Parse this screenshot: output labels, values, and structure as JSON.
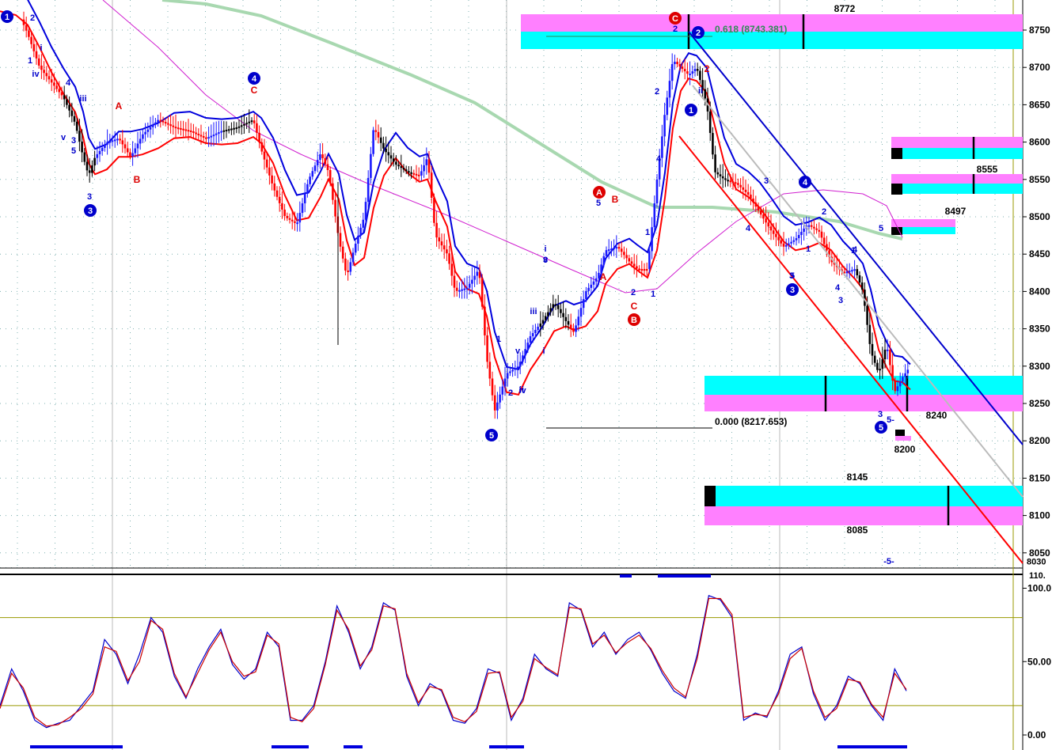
{
  "chart_data": [
    {
      "type": "candlestick",
      "panel": "price",
      "y_axis": {
        "ticks": [
          "8750",
          "8700",
          "8650",
          "8600",
          "8550",
          "8500",
          "8450",
          "8400",
          "8350",
          "8300",
          "8250",
          "8200",
          "8150",
          "8100",
          "8050",
          "8030"
        ],
        "range": [
          8030,
          8785
        ]
      },
      "grid": true,
      "close_path": [
        [
          0,
          8790
        ],
        [
          20,
          8780
        ],
        [
          35,
          8745
        ],
        [
          50,
          8700
        ],
        [
          65,
          8680
        ],
        [
          80,
          8660
        ],
        [
          95,
          8625
        ],
        [
          105,
          8580
        ],
        [
          112,
          8555
        ],
        [
          120,
          8580
        ],
        [
          135,
          8600
        ],
        [
          150,
          8605
        ],
        [
          165,
          8580
        ],
        [
          180,
          8610
        ],
        [
          200,
          8630
        ],
        [
          220,
          8620
        ],
        [
          240,
          8615
        ],
        [
          260,
          8605
        ],
        [
          280,
          8615
        ],
        [
          300,
          8620
        ],
        [
          320,
          8630
        ],
        [
          330,
          8590
        ],
        [
          345,
          8540
        ],
        [
          360,
          8500
        ],
        [
          375,
          8490
        ],
        [
          390,
          8550
        ],
        [
          405,
          8585
        ],
        [
          415,
          8560
        ],
        [
          428,
          8470
        ],
        [
          438,
          8420
        ],
        [
          448,
          8460
        ],
        [
          460,
          8500
        ],
        [
          472,
          8620
        ],
        [
          485,
          8590
        ],
        [
          500,
          8570
        ],
        [
          515,
          8560
        ],
        [
          530,
          8555
        ],
        [
          540,
          8580
        ],
        [
          550,
          8475
        ],
        [
          565,
          8450
        ],
        [
          575,
          8400
        ],
        [
          590,
          8405
        ],
        [
          605,
          8430
        ],
        [
          615,
          8310
        ],
        [
          625,
          8240
        ],
        [
          640,
          8290
        ],
        [
          655,
          8300
        ],
        [
          670,
          8340
        ],
        [
          685,
          8360
        ],
        [
          700,
          8385
        ],
        [
          715,
          8360
        ],
        [
          725,
          8345
        ],
        [
          740,
          8400
        ],
        [
          755,
          8420
        ],
        [
          765,
          8455
        ],
        [
          780,
          8460
        ],
        [
          795,
          8440
        ],
        [
          805,
          8430
        ],
        [
          818,
          8430
        ],
        [
          830,
          8550
        ],
        [
          840,
          8640
        ],
        [
          850,
          8710
        ],
        [
          860,
          8700
        ],
        [
          870,
          8690
        ],
        [
          880,
          8700
        ],
        [
          893,
          8650
        ],
        [
          903,
          8560
        ],
        [
          915,
          8550
        ],
        [
          930,
          8545
        ],
        [
          945,
          8530
        ],
        [
          960,
          8505
        ],
        [
          975,
          8480
        ],
        [
          990,
          8460
        ],
        [
          1005,
          8470
        ],
        [
          1020,
          8490
        ],
        [
          1035,
          8480
        ],
        [
          1050,
          8440
        ],
        [
          1065,
          8425
        ],
        [
          1080,
          8430
        ],
        [
          1090,
          8400
        ],
        [
          1100,
          8320
        ],
        [
          1110,
          8290
        ],
        [
          1120,
          8330
        ],
        [
          1130,
          8265
        ],
        [
          1140,
          8285
        ],
        [
          1150,
          8300
        ]
      ],
      "annotations": {
        "fib": [
          "0.618 (8743.381)",
          "0.000 (8217.653)"
        ],
        "zone_labels": [
          "8772",
          "8555",
          "8497",
          "8240",
          "8200",
          "8145",
          "8085"
        ],
        "waves_blue_circles": [
          "1",
          "3",
          "4",
          "5",
          "2",
          "1",
          "3",
          "4",
          "5"
        ],
        "waves_red_circles": [
          "C",
          "A",
          "B"
        ],
        "wave_text": [
          "2",
          "1",
          "i",
          "iv",
          "4",
          "iii",
          "v",
          "3",
          "5",
          "3",
          "i",
          "iii",
          "v",
          "ii",
          "1",
          "2",
          "5",
          "4",
          "1",
          "2",
          "3",
          "v",
          "i",
          "iv",
          "ii",
          "1",
          "2",
          "3",
          "4",
          "5",
          "4",
          "3",
          "1",
          "2",
          "1",
          "3",
          "5",
          "4",
          "2",
          "3",
          "5-",
          "-5-"
        ],
        "wave_text_red": [
          "A",
          "B",
          "C",
          "A",
          "B",
          "C",
          "2"
        ]
      }
    },
    {
      "type": "line",
      "panel": "oscillator",
      "y_axis": {
        "ticks": [
          "100.0",
          "50.00",
          "0.00"
        ],
        "range": [
          0,
          110
        ],
        "top_label": "110."
      },
      "series": [
        {
          "color": "#0000cc",
          "values": [
            20,
            45,
            30,
            10,
            5,
            8,
            10,
            20,
            30,
            65,
            55,
            35,
            55,
            80,
            70,
            40,
            25,
            45,
            60,
            72,
            48,
            38,
            45,
            70,
            60,
            10,
            10,
            20,
            50,
            88,
            70,
            45,
            60,
            90,
            85,
            40,
            20,
            35,
            30,
            10,
            8,
            18,
            45,
            42,
            10,
            25,
            55,
            45,
            40,
            90,
            85,
            60,
            70,
            55,
            65,
            70,
            58,
            42,
            30,
            25,
            55,
            95,
            92,
            80,
            10,
            15,
            12,
            30,
            55,
            60,
            28,
            10,
            20,
            40,
            35,
            20,
            10,
            45,
            30
          ]
        },
        {
          "color": "#cc0000",
          "values": [
            18,
            42,
            32,
            12,
            6,
            7,
            12,
            18,
            28,
            60,
            57,
            37,
            50,
            78,
            72,
            42,
            26,
            42,
            58,
            70,
            50,
            40,
            43,
            68,
            62,
            12,
            9,
            18,
            48,
            85,
            72,
            47,
            58,
            88,
            86,
            42,
            22,
            33,
            31,
            12,
            9,
            16,
            42,
            43,
            12,
            23,
            52,
            46,
            41,
            87,
            86,
            62,
            68,
            56,
            63,
            68,
            59,
            44,
            32,
            26,
            52,
            93,
            93,
            82,
            12,
            14,
            13,
            28,
            52,
            59,
            30,
            12,
            18,
            38,
            36,
            21,
            12,
            42,
            31
          ]
        }
      ],
      "levels": [
        80,
        20
      ]
    }
  ],
  "colors": {
    "up_candle": "#1a1aff",
    "down_candle": "#ff0000",
    "neutral_candle": "#000000",
    "fast_ma": "#ff0000",
    "slow_ma": "#0000dd",
    "ma_magenta": "#d020d0",
    "ma_green": "#a8d8b0",
    "zone_cyan": "#00ffff",
    "zone_magenta": "#ff80ff",
    "channel_upper": "#0000cc",
    "channel_lower": "#ff0000",
    "channel_gray": "#bbbbbb",
    "osc_level": "#999900",
    "grid": "#7fb0b0"
  }
}
